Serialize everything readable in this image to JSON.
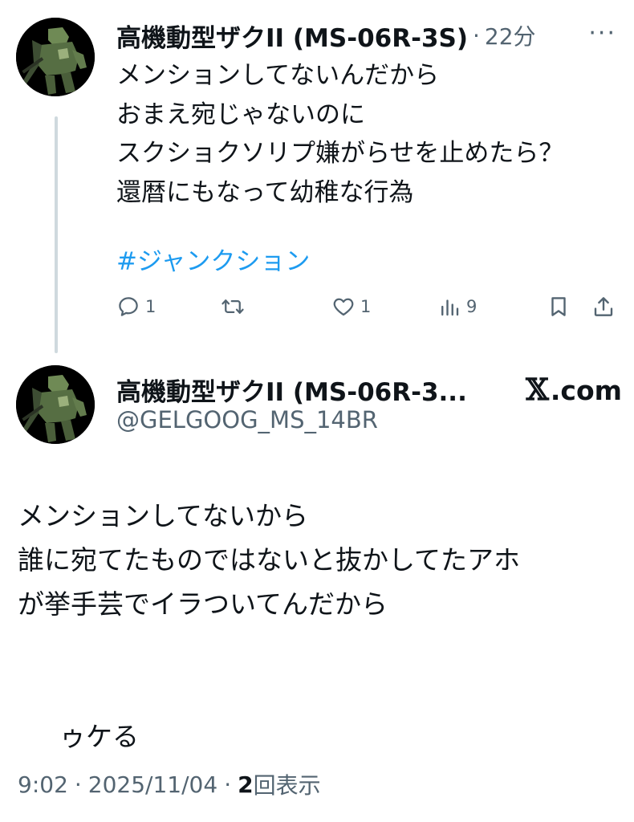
{
  "tweet1": {
    "display_name": "高機動型ザクII (MS-06R-3S)",
    "time_ago": "22分",
    "separator": "·",
    "more_glyph": "···",
    "lines": [
      "メンションしてないんだから",
      "おまえ宛じゃないのに",
      "スクショクソリプ嫌がらせを止めたら？",
      "還暦にもなって幼稚な行為"
    ],
    "hashtag": "#ジャンクション",
    "actions": {
      "reply_count": "1",
      "retweet_count": "",
      "like_count": "1",
      "views_count": "9"
    }
  },
  "tweet2": {
    "display_name": "高機動型ザクII (MS-06R-3...",
    "brand_x": "𝕏",
    "brand_text": ".com",
    "handle": "@GELGOOG_MS_14BR",
    "lines": [
      "メンションしてないから",
      "誰に宛てたものではないと抜かしてたアホ",
      "が挙手芸でイラついてんだから",
      "",
      "ゥケる"
    ],
    "footer": {
      "time": "9:02",
      "separator": "·",
      "date": "2025/11/04",
      "views": "2",
      "views_label": "回表示"
    }
  },
  "colors": {
    "text": "#0f1419",
    "secondary": "#536471",
    "link": "#1d9bf0",
    "thread_line": "#cfd9de"
  },
  "icons": [
    "avatar",
    "reply-icon",
    "retweet-icon",
    "like-icon",
    "views-icon",
    "bookmark-icon",
    "share-icon"
  ]
}
